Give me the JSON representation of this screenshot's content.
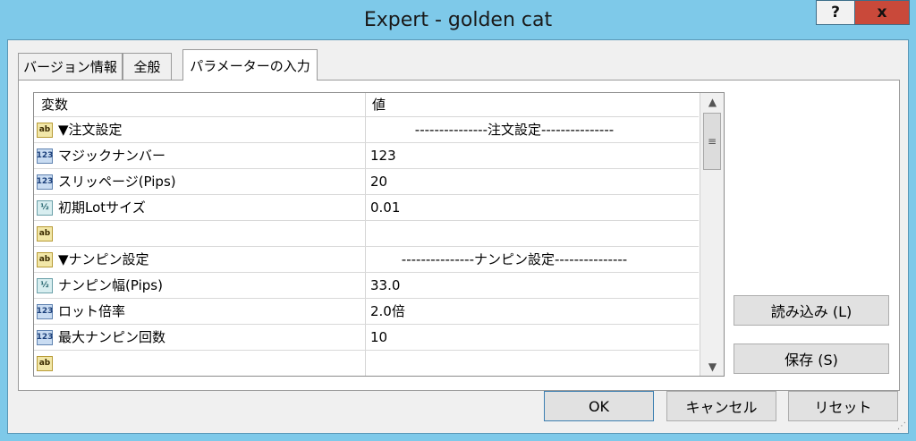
{
  "window": {
    "title": "Expert - golden cat",
    "help_label": "?",
    "close_label": "x"
  },
  "tabs": [
    {
      "label": "バージョン情報"
    },
    {
      "label": "全般"
    },
    {
      "label": "パラメーターの入力"
    }
  ],
  "grid": {
    "headers": {
      "variable": "変数",
      "value": "値"
    },
    "rows": [
      {
        "icon": "ab",
        "name": "▼注文設定",
        "value": "---------------注文設定---------------"
      },
      {
        "icon": "123",
        "name": "マジックナンバー",
        "value": "123"
      },
      {
        "icon": "123",
        "name": "スリッページ(Pips)",
        "value": "20"
      },
      {
        "icon": "1/2",
        "name": "初期Lotサイズ",
        "value": "0.01"
      },
      {
        "icon": "ab",
        "name": "",
        "value": ""
      },
      {
        "icon": "ab",
        "name": "▼ナンピン設定",
        "value": "---------------ナンピン設定---------------"
      },
      {
        "icon": "1/2",
        "name": "ナンピン幅(Pips)",
        "value": "33.0"
      },
      {
        "icon": "123",
        "name": "ロット倍率",
        "value": "2.0倍"
      },
      {
        "icon": "123",
        "name": "最大ナンピン回数",
        "value": "10"
      },
      {
        "icon": "ab",
        "name": "",
        "value": ""
      }
    ],
    "icon_labels": {
      "ab": "ab",
      "123": "123",
      "half": "½"
    }
  },
  "buttons": {
    "load": "読み込み (L)",
    "save": "保存 (S)",
    "ok": "OK",
    "cancel": "キャンセル",
    "reset": "リセット"
  },
  "colors": {
    "title_bg": "#7ec9e9",
    "close_bg": "#c9493a"
  }
}
